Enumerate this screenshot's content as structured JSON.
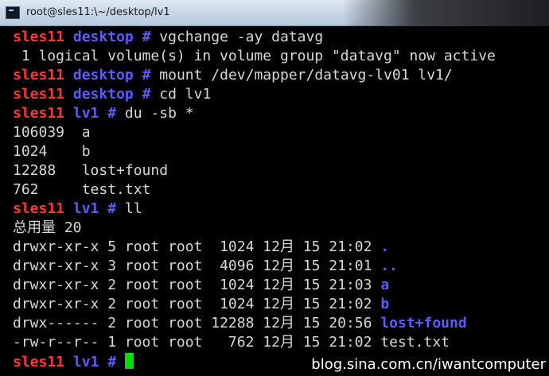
{
  "window": {
    "title": "root@sles11:\\~/desktop/lv1"
  },
  "colors": {
    "hostname": "#ff3636",
    "directory": "#5b5bff",
    "text": "#d8d8d8",
    "cursor": "#00e000"
  },
  "prompt_host": "sles11",
  "lines": {
    "l1": {
      "dir": "desktop",
      "cmd": "vgchange -ay datavg"
    },
    "l2": {
      "text": " 1 logical volume(s) in volume group \"datavg\" now active"
    },
    "l3": {
      "dir": "desktop",
      "cmd": "mount /dev/mapper/datavg-lv01 lv1/"
    },
    "l4": {
      "dir": "desktop",
      "cmd": "cd lv1"
    },
    "l5": {
      "dir": "lv1",
      "cmd": "du -sb *"
    },
    "l6": {
      "text": "106039  a"
    },
    "l7": {
      "text": "1024    b"
    },
    "l8": {
      "text": "12288   lost+found"
    },
    "l9": {
      "text": "762     test.txt"
    },
    "l10": {
      "dir": "lv1",
      "cmd": "ll"
    },
    "l11": {
      "text": "总用量 20"
    },
    "l12": {
      "meta": "drwxr-xr-x 5 root root  1024 12月 15 21:02 ",
      "name": "."
    },
    "l13": {
      "meta": "drwxr-xr-x 3 root root  4096 12月 15 21:01 ",
      "name": ".."
    },
    "l14": {
      "meta": "drwxr-xr-x 2 root root  1024 12月 15 21:03 ",
      "name": "a"
    },
    "l15": {
      "meta": "drwxr-xr-x 2 root root  1024 12月 15 21:02 ",
      "name": "b"
    },
    "l16": {
      "meta": "drwx------ 2 root root 12288 12月 15 20:56 ",
      "name": "lost+found"
    },
    "l17": {
      "meta": "-rw-r--r-- 1 root root   762 12月 15 21:02 ",
      "name": "test.txt"
    },
    "l18": {
      "dir": "lv1"
    }
  },
  "watermark": "blog.sina.com.cn/iwantcomputer"
}
